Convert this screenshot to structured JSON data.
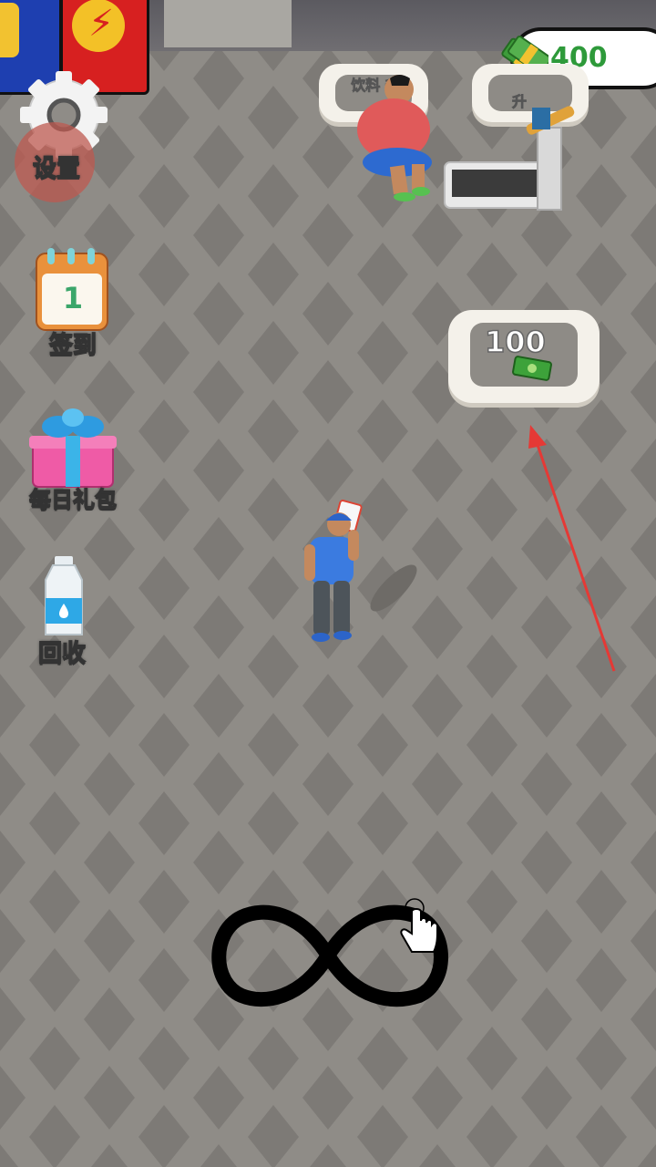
{
  "hud": {
    "money": "400",
    "money_icon": "cash-stack-icon"
  },
  "side_menu": {
    "settings_label": "设置",
    "checkin_label": "签到",
    "checkin_day": "1",
    "gift_label": "每日礼包",
    "recycle_label": "回收"
  },
  "world": {
    "upgrade_pad_price": "100",
    "top_pad_1_label": "饮料 升",
    "top_pad_2_label": "升"
  },
  "tutorial": {
    "gesture": "infinity-swipe",
    "hand_icon": "pointing-hand-icon",
    "arrow_color": "#e53935"
  },
  "colors": {
    "floor": "#8f8c87",
    "money_text": "#2e9a3a"
  }
}
